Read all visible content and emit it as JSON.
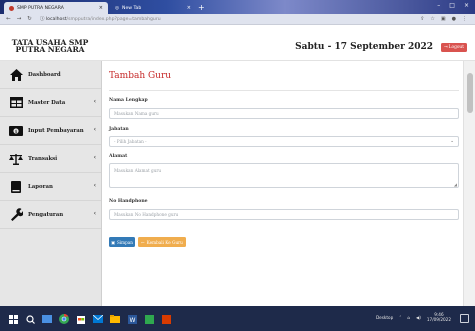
{
  "browser": {
    "tabs": [
      {
        "label": "SMP PUTRA NEGARA",
        "active": true
      },
      {
        "label": "New Tab",
        "active": false
      }
    ],
    "url_host": "localhost",
    "url_path": "/smpputra/index.php?page=tambahguru"
  },
  "header": {
    "brand_line1": "TATA USAHA SMP",
    "brand_line2": "PUTRA NEGARA",
    "date": "Sabtu - 17 September 2022",
    "logout_label": "Logout"
  },
  "sidebar": {
    "items": [
      {
        "label": "Dashboard",
        "icon": "home-icon",
        "has_chevron": false
      },
      {
        "label": "Master Data",
        "icon": "table-icon",
        "has_chevron": true
      },
      {
        "label": "Input Pembayaran",
        "icon": "money-icon",
        "has_chevron": true
      },
      {
        "label": "Transaksi",
        "icon": "scale-icon",
        "has_chevron": true
      },
      {
        "label": "Laporan",
        "icon": "book-icon",
        "has_chevron": true
      },
      {
        "label": "Pengaturan",
        "icon": "wrench-icon",
        "has_chevron": true
      }
    ]
  },
  "main": {
    "title": "Tambah Guru",
    "fields": {
      "nama_label": "Nama Lengkap",
      "nama_placeholder": "Masukan Nama guru",
      "jabatan_label": "Jabatan",
      "jabatan_value": "- Pilih Jabatan -",
      "alamat_label": "Alamat",
      "alamat_placeholder": "Masukan Alamat guru",
      "hp_label": "No Handphone",
      "hp_placeholder": "Masukan No Handphone guru"
    },
    "save_label": "Simpan",
    "back_label": "Kembali Ke Guru"
  },
  "taskbar": {
    "desktop_label": "Desktop",
    "time": "9:46",
    "date": "17/09/2022"
  },
  "colors": {
    "accent_red": "#c62828",
    "logout": "#d9534f",
    "primary": "#337ab7",
    "warning": "#f0ad4e",
    "sidebar_bg": "#e6e6e6"
  }
}
